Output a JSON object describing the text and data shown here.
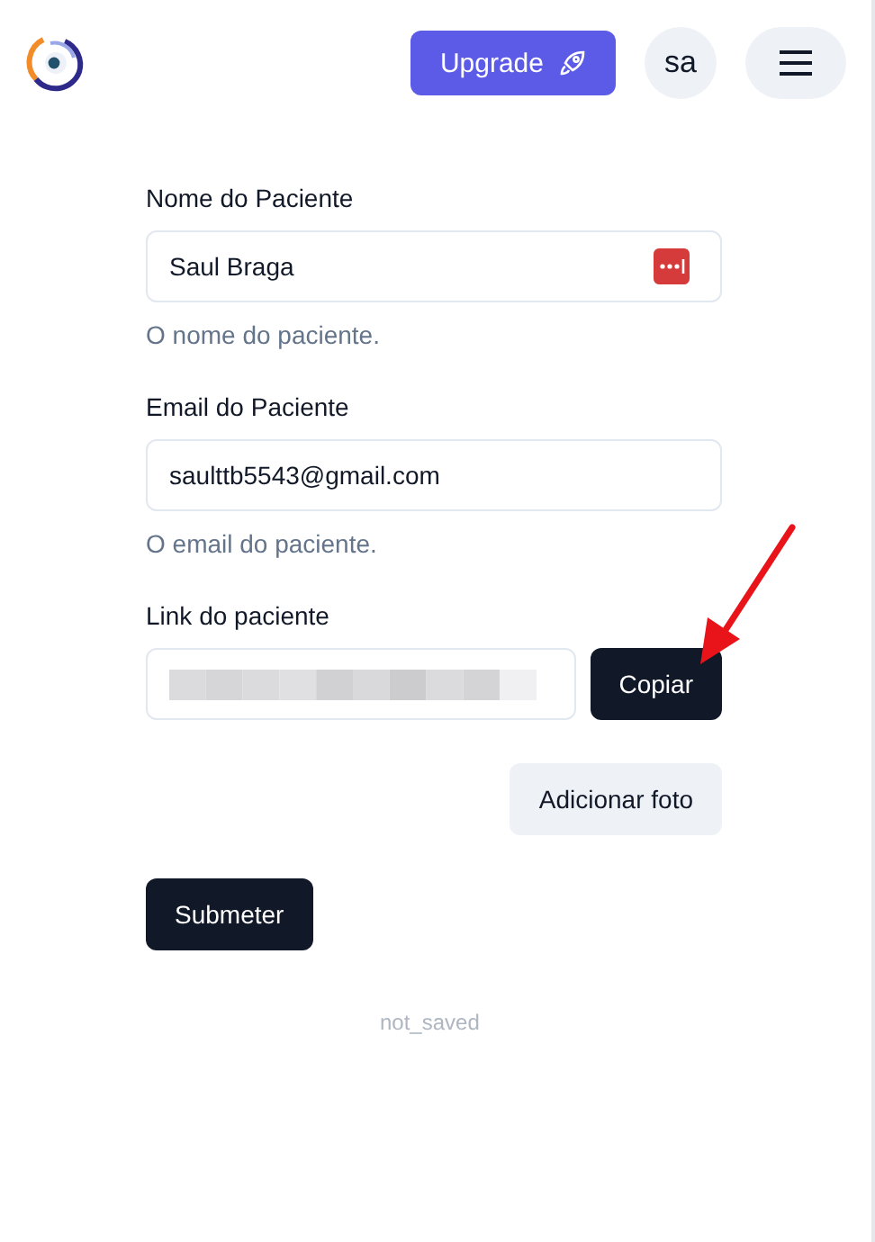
{
  "header": {
    "upgrade_button": "Upgrade",
    "avatar": "sa"
  },
  "fields": [
    {
      "kind": "text",
      "label": "Nome do Paciente",
      "value": "Saul Braga",
      "hint": "O nome do paciente.",
      "password_manager": true
    },
    {
      "kind": "text",
      "label": "Email do Paciente",
      "value": "saulttb5543@gmail.com",
      "hint": "O email do paciente.",
      "password_manager": false
    },
    {
      "kind": "link",
      "label": "Link do paciente",
      "button": "Copiar"
    }
  ],
  "photo_button": "Adicionar foto",
  "submit_button": "Submeter",
  "status": "not_saved"
}
